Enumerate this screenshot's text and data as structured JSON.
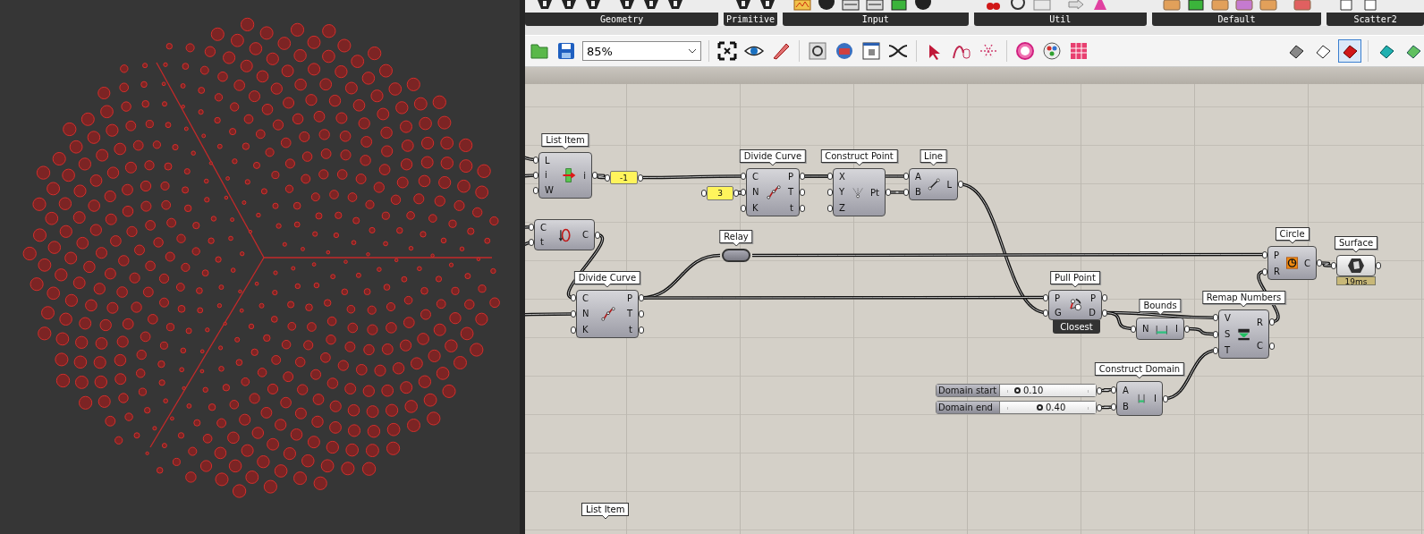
{
  "ribbon": {
    "groups": [
      {
        "label": "Geometry"
      },
      {
        "label": "Primitive"
      },
      {
        "label": "Input"
      },
      {
        "label": "Util"
      },
      {
        "label": "Default"
      },
      {
        "label": "Scatter2"
      }
    ]
  },
  "toolbar": {
    "zoom": "85%"
  },
  "canvas": {
    "nodes": [
      {
        "kind": "component",
        "label": "List Item",
        "inputs": [
          "L",
          "i",
          "W"
        ],
        "outputs": [
          "i"
        ]
      },
      {
        "kind": "panel",
        "text": "-1"
      },
      {
        "kind": "component",
        "inputs": [
          "C",
          "t"
        ],
        "outputs": [
          "C"
        ]
      },
      {
        "kind": "panel",
        "text": "3"
      },
      {
        "kind": "component",
        "label": "Divide Curve",
        "inputs": [
          "C",
          "N",
          "K"
        ],
        "outputs": [
          "P",
          "T",
          "t"
        ]
      },
      {
        "kind": "component",
        "label": "Construct Point",
        "inputs": [
          "X",
          "Y",
          "Z"
        ],
        "outputs": [
          "Pt"
        ]
      },
      {
        "kind": "component",
        "label": "Line",
        "inputs": [
          "A",
          "B"
        ],
        "outputs": [
          "L"
        ]
      },
      {
        "kind": "relay",
        "label": "Relay"
      },
      {
        "kind": "component",
        "label": "Divide Curve",
        "inputs": [
          "C",
          "N",
          "K"
        ],
        "outputs": [
          "P",
          "T",
          "t"
        ]
      },
      {
        "kind": "component",
        "label": "Circle",
        "inputs": [
          "P",
          "R"
        ],
        "outputs": [
          "C"
        ]
      },
      {
        "kind": "param",
        "label": "Surface",
        "profiler": "19ms"
      },
      {
        "kind": "component",
        "label": "Pull Point",
        "inputs": [
          "P",
          "G"
        ],
        "outputs": [
          "P",
          "D"
        ],
        "message": "Closest"
      },
      {
        "kind": "component",
        "label": "Bounds",
        "inputs": [
          "N"
        ],
        "outputs": [
          "I"
        ]
      },
      {
        "kind": "component",
        "label": "Remap Numbers",
        "inputs": [
          "V",
          "S",
          "T"
        ],
        "outputs": [
          "R",
          "C"
        ]
      },
      {
        "kind": "slider",
        "name": "Domain start",
        "value": "0.10",
        "level": 0.16
      },
      {
        "kind": "slider",
        "name": "Domain end",
        "value": "0.40",
        "level": 0.41
      },
      {
        "kind": "component",
        "label": "Construct Domain",
        "inputs": [
          "A",
          "B"
        ],
        "outputs": [
          "I"
        ]
      }
    ],
    "tags": [
      {
        "text": "List Item"
      }
    ]
  }
}
